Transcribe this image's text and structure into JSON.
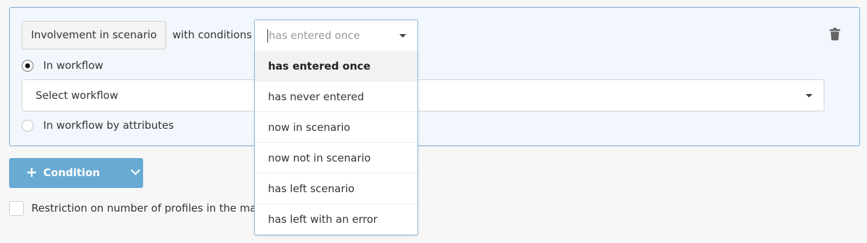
{
  "condition_block": {
    "type_button_label": "Involvement in scenario",
    "with_conditions_label": "with conditions",
    "conditions_select": {
      "placeholder": "has entered once",
      "options": [
        {
          "label": "has entered once",
          "selected": true
        },
        {
          "label": "has never entered",
          "selected": false
        },
        {
          "label": "now in scenario",
          "selected": false
        },
        {
          "label": "now not in scenario",
          "selected": false
        },
        {
          "label": "has left scenario",
          "selected": false
        },
        {
          "label": "has left with an error",
          "selected": false
        }
      ]
    },
    "delete_icon": "trash-icon",
    "radio_options": [
      {
        "label": "In workflow",
        "checked": true
      },
      {
        "label": "In workflow by attributes",
        "checked": false
      }
    ],
    "workflow_select": {
      "value": "Select workflow"
    }
  },
  "add_condition_button": {
    "label": "Condition",
    "icon": "plus-icon",
    "dropdown_icon": "chevron-down-icon"
  },
  "restriction_checkbox": {
    "label": "Restriction on number of profiles in the max se",
    "checked": false
  },
  "colors": {
    "accent": "#69aad3",
    "panel_bg": "#f1f7fd",
    "panel_border": "#7aaad8"
  }
}
